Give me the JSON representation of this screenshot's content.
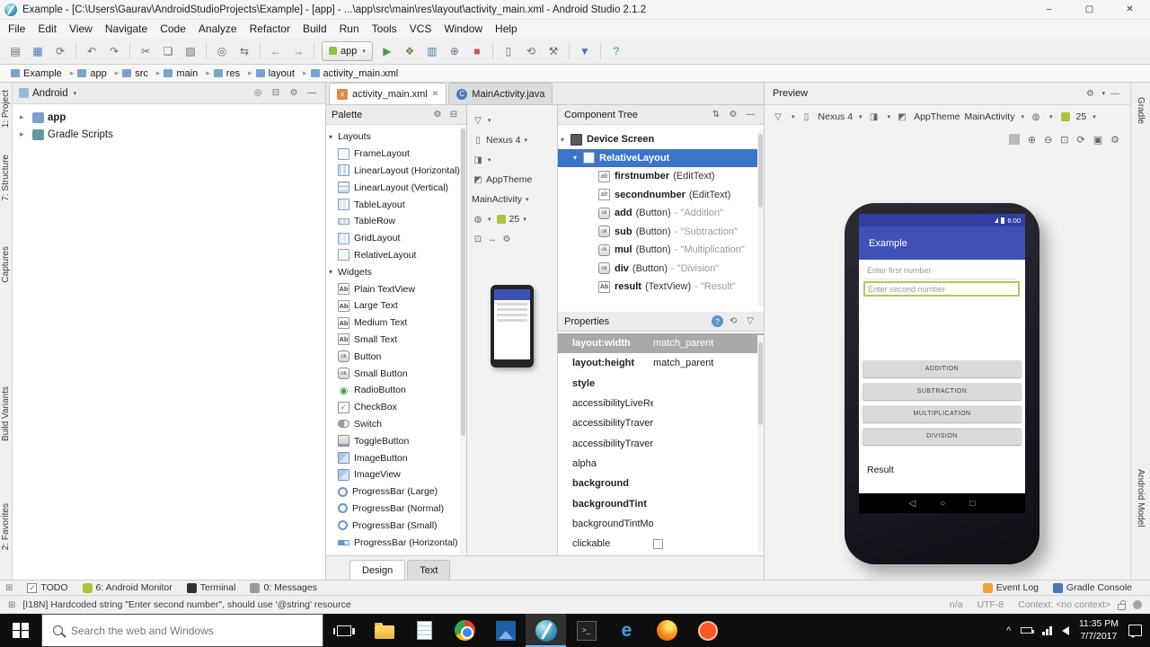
{
  "colors": {
    "app_primary": "#3F51B5",
    "app_primary_dark": "#303F9F",
    "tree_selection": "#3b74c8",
    "android_green": "#a4c639",
    "field_highlight": "#b9c35a",
    "taskbar_bg": "#0e0e0e"
  },
  "window": {
    "title": "Example - [C:\\Users\\Gaurav\\AndroidStudioProjects\\Example] - [app] - ...\\app\\src\\main\\res\\layout\\activity_main.xml - Android Studio 2.1.2",
    "controls": {
      "minimize": "–",
      "maximize": "▢",
      "close": "✕"
    }
  },
  "icons": {
    "caret": "▾",
    "open": "▤",
    "save": "▦",
    "sync": "⟳",
    "undo": "↶",
    "redo": "↷",
    "cut": "✂",
    "copy": "❏",
    "paste": "▨",
    "find": "◎",
    "replace": "⇆",
    "back": "←",
    "forward": "→",
    "run": "▶",
    "debug": "❖",
    "coverage": "▥",
    "attach": "⊕",
    "stop": "■",
    "avd": "▯",
    "sync_project": "⟲",
    "build": "⚒",
    "sdk": "▼",
    "help": "?",
    "settings": "⚙",
    "hide": "—",
    "collapse": "⊟",
    "locate": "◎",
    "corner": "⊞",
    "sort": "⇅",
    "filter": "▽",
    "reset": "⟲",
    "device": "▯",
    "orientation": "◨",
    "theme": "◩",
    "globe": "◍",
    "zoom_fit": "⊡",
    "pan": "↔",
    "zoom_in": "⊕",
    "zoom_out": "⊖",
    "refresh": "⟳",
    "screenshot": "▣",
    "nav_back": "◁",
    "nav_home": "○",
    "nav_recent": "□",
    "tray_chevron": "^",
    "cmd": ">_",
    "edge": "e",
    "check": "✓"
  },
  "menu_bar": [
    "File",
    "Edit",
    "View",
    "Navigate",
    "Code",
    "Analyze",
    "Refactor",
    "Build",
    "Run",
    "Tools",
    "VCS",
    "Window",
    "Help"
  ],
  "toolbar": {
    "run_config": "app"
  },
  "breadcrumbs": [
    "Example",
    "app",
    "src",
    "main",
    "res",
    "layout",
    "activity_main.xml"
  ],
  "stripes": {
    "left": [
      "1: Project",
      "7: Structure",
      "Captures",
      "Build Variants",
      "2: Favorites"
    ],
    "right": [
      "Gradle",
      "Android Model"
    ]
  },
  "project": {
    "mode": "Android",
    "items": [
      {
        "chev": "▸",
        "ic": "mod",
        "g": "",
        "label": "app",
        "cls": "bold"
      },
      {
        "chev": "▸",
        "ic": "gradle",
        "g": "",
        "label": "Gradle Scripts",
        "cls": ""
      }
    ]
  },
  "editor": {
    "tabs": [
      {
        "ic": "xml",
        "icg": "x",
        "label": "activity_main.xml",
        "close": "show",
        "cls": "selected"
      },
      {
        "ic": "java",
        "icg": "C",
        "label": "MainActivity.java",
        "close": "",
        "cls": ""
      }
    ],
    "bottom_tabs": [
      {
        "label": "Design",
        "cls": "selected"
      },
      {
        "label": "Text",
        "cls": ""
      }
    ]
  },
  "palette": {
    "title": "Palette",
    "rows": [
      {
        "t": "header",
        "chev": "▾",
        "label": "Layouts",
        "ic": "",
        "g": ""
      },
      {
        "t": "item",
        "chev": "",
        "label": "FrameLayout",
        "ic": "lay",
        "g": ""
      },
      {
        "t": "item",
        "chev": "",
        "label": "LinearLayout (Horizontal)",
        "ic": "layh",
        "g": ""
      },
      {
        "t": "item",
        "chev": "",
        "label": "LinearLayout (Vertical)",
        "ic": "layv",
        "g": ""
      },
      {
        "t": "item",
        "chev": "",
        "label": "TableLayout",
        "ic": "tbl",
        "g": ""
      },
      {
        "t": "item",
        "chev": "",
        "label": "TableRow",
        "ic": "tblr",
        "g": ""
      },
      {
        "t": "item",
        "chev": "",
        "label": "GridLayout",
        "ic": "grid",
        "g": ""
      },
      {
        "t": "item",
        "chev": "",
        "label": "RelativeLayout",
        "ic": "rel",
        "g": ""
      },
      {
        "t": "header",
        "chev": "▾",
        "label": "Widgets",
        "ic": "",
        "g": ""
      },
      {
        "t": "item",
        "chev": "",
        "label": "Plain TextView",
        "ic": "txt",
        "g": "Ab"
      },
      {
        "t": "item",
        "chev": "",
        "label": "Large Text",
        "ic": "txt",
        "g": "Ab"
      },
      {
        "t": "item",
        "chev": "",
        "label": "Medium Text",
        "ic": "txt",
        "g": "Ab"
      },
      {
        "t": "item",
        "chev": "",
        "label": "Small Text",
        "ic": "txt",
        "g": "Ab"
      },
      {
        "t": "item",
        "chev": "",
        "label": "Button",
        "ic": "btn",
        "g": "ok"
      },
      {
        "t": "item",
        "chev": "",
        "label": "Small Button",
        "ic": "btn",
        "g": "ok"
      },
      {
        "t": "item",
        "chev": "",
        "label": "RadioButton",
        "ic": "grn",
        "g": "◉"
      },
      {
        "t": "item",
        "chev": "",
        "label": "CheckBox",
        "ic": "chk",
        "g": "✓"
      },
      {
        "t": "item",
        "chev": "",
        "label": "Switch",
        "ic": "sw",
        "g": ""
      },
      {
        "t": "item",
        "chev": "",
        "label": "ToggleButton",
        "ic": "tog",
        "g": ""
      },
      {
        "t": "item",
        "chev": "",
        "label": "ImageButton",
        "ic": "img",
        "g": ""
      },
      {
        "t": "item",
        "chev": "",
        "label": "ImageView",
        "ic": "img",
        "g": ""
      },
      {
        "t": "item",
        "chev": "",
        "label": "ProgressBar (Large)",
        "ic": "pbl",
        "g": ""
      },
      {
        "t": "item",
        "chev": "",
        "label": "ProgressBar (Normal)",
        "ic": "pbl",
        "g": ""
      },
      {
        "t": "item",
        "chev": "",
        "label": "ProgressBar (Small)",
        "ic": "pbl",
        "g": ""
      },
      {
        "t": "item",
        "chev": "",
        "label": "ProgressBar (Horizontal)",
        "ic": "pbh",
        "g": ""
      }
    ]
  },
  "design_bar": {
    "device": "Nexus 4",
    "theme": "AppTheme",
    "activity": "MainActivity",
    "api": "25"
  },
  "component_tree": {
    "title": "Component Tree",
    "items": [
      {
        "lvl": "l0",
        "chev": "▾",
        "ic": "dev",
        "g": "",
        "label": "Device Screen",
        "type": "",
        "text": "",
        "cls": ""
      },
      {
        "lvl": "l1",
        "chev": "▾",
        "ic": "rel",
        "g": "",
        "label": "RelativeLayout",
        "type": "",
        "text": "",
        "cls": "selected"
      },
      {
        "lvl": "l2",
        "chev": "",
        "ic": "edt",
        "g": "ab",
        "label": "firstnumber",
        "type": "(EditText)",
        "text": "",
        "cls": ""
      },
      {
        "lvl": "l2",
        "chev": "",
        "ic": "edt",
        "g": "ab",
        "label": "secondnumber",
        "type": "(EditText)",
        "text": "",
        "cls": ""
      },
      {
        "lvl": "l2",
        "chev": "",
        "ic": "btn",
        "g": "ok",
        "label": "add",
        "type": "(Button)",
        "text": "- \"Addition\"",
        "cls": ""
      },
      {
        "lvl": "l2",
        "chev": "",
        "ic": "btn",
        "g": "ok",
        "label": "sub",
        "type": "(Button)",
        "text": "- \"Subtraction\"",
        "cls": ""
      },
      {
        "lvl": "l2",
        "chev": "",
        "ic": "btn",
        "g": "ok",
        "label": "mul",
        "type": "(Button)",
        "text": "- \"Multiplication\"",
        "cls": ""
      },
      {
        "lvl": "l2",
        "chev": "",
        "ic": "btn",
        "g": "ok",
        "label": "div",
        "type": "(Button)",
        "text": "- \"Division\"",
        "cls": ""
      },
      {
        "lvl": "l2",
        "chev": "",
        "ic": "txt",
        "g": "Ab",
        "label": "result",
        "type": "(TextView)",
        "text": "- \"Result\"",
        "cls": ""
      }
    ]
  },
  "properties": {
    "title": "Properties",
    "rows": [
      {
        "label": "layout:width",
        "value": "match_parent",
        "cls": "selected bold",
        "check": ""
      },
      {
        "label": "layout:height",
        "value": "match_parent",
        "cls": "bold",
        "check": ""
      },
      {
        "label": "style",
        "value": "",
        "cls": "bold",
        "check": ""
      },
      {
        "label": "accessibilityLiveRegion",
        "value": "",
        "cls": "",
        "check": ""
      },
      {
        "label": "accessibilityTraversalAfter",
        "value": "",
        "cls": "",
        "check": ""
      },
      {
        "label": "accessibilityTraversalBefore",
        "value": "",
        "cls": "",
        "check": ""
      },
      {
        "label": "alpha",
        "value": "",
        "cls": "",
        "check": ""
      },
      {
        "label": "background",
        "value": "",
        "cls": "bold",
        "check": ""
      },
      {
        "label": "backgroundTint",
        "value": "",
        "cls": "bold",
        "check": ""
      },
      {
        "label": "backgroundTintMode",
        "value": "",
        "cls": "",
        "check": ""
      },
      {
        "label": "clickable",
        "value": "",
        "cls": "",
        "check": "show"
      }
    ]
  },
  "preview": {
    "title": "Preview",
    "device": "Nexus 4",
    "theme": "AppTheme",
    "activity": "MainActivity",
    "api": "25"
  },
  "phone": {
    "time": "6:00",
    "app_title": "Example",
    "hint_first": "Enter first number",
    "hint_second": "Enter second number",
    "buttons": [
      "ADDITION",
      "SUBTRACTION",
      "MULTIPLICATION",
      "DIVISION"
    ],
    "result_label": "Result"
  },
  "tool_windows": {
    "left": [
      {
        "g": "✓",
        "ic": "todo",
        "label": "TODO"
      },
      {
        "g": "",
        "ic": "android",
        "label": "6: Android Monitor"
      },
      {
        "g": "",
        "ic": "term",
        "label": "Terminal"
      },
      {
        "g": "",
        "ic": "msg",
        "label": "0: Messages"
      }
    ],
    "right": [
      {
        "g": "",
        "ic": "evt",
        "label": "Event Log"
      },
      {
        "g": "",
        "ic": "gc",
        "label": "Gradle Console"
      }
    ]
  },
  "status_bar": {
    "message": "[I18N] Hardcoded string \"Enter second number\", should use '@string' resource",
    "right": [
      "n/a",
      "UTF-8",
      "Context: <no context>"
    ]
  },
  "taskbar": {
    "search_placeholder": "Search the web and Windows",
    "active_app": "android-studio",
    "time": "11:35 PM",
    "date": "7/7/2017"
  }
}
